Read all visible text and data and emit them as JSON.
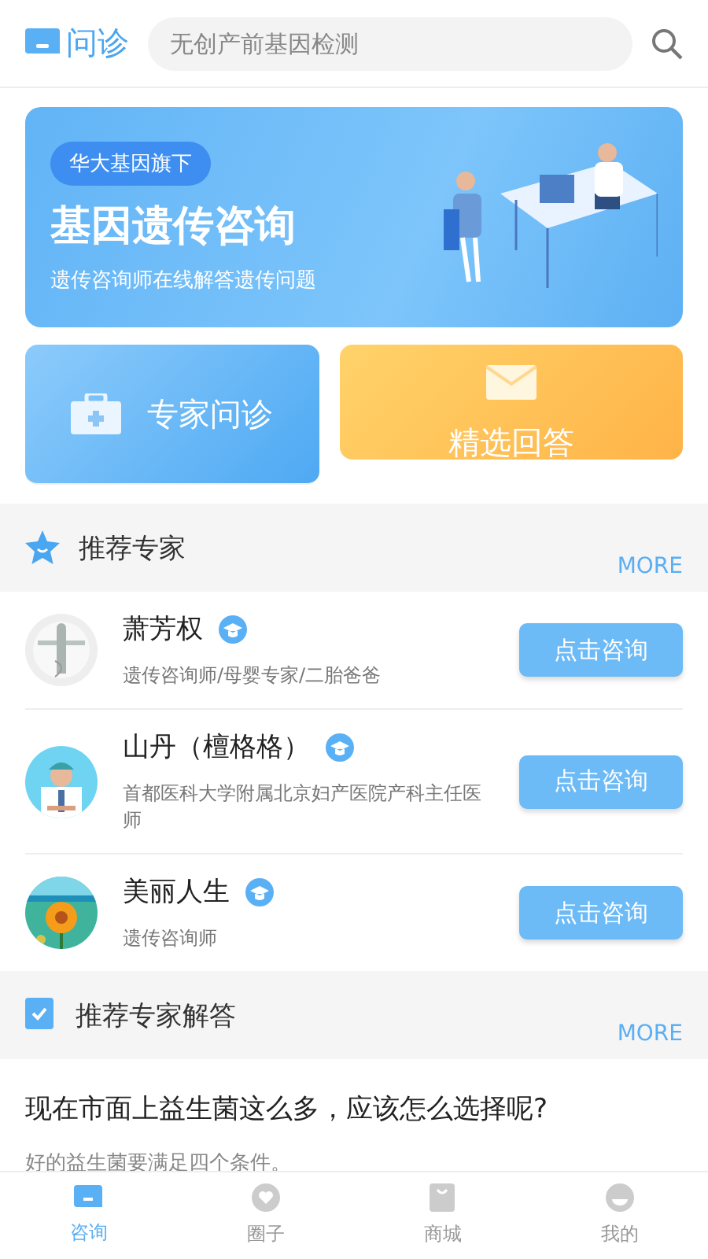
{
  "header": {
    "logo_text": "问诊",
    "search": {
      "placeholder": "无创产前基因检测"
    }
  },
  "banner": {
    "badge": "华大基因旗下",
    "title": "基因遗传咨询",
    "subtitle": "遗传咨询师在线解答遗传问题"
  },
  "shortcuts": [
    {
      "kind": "expert",
      "label": "专家问诊"
    },
    {
      "kind": "answers",
      "label": "精选回答"
    }
  ],
  "experts_section": {
    "title": "推荐专家",
    "more": "MORE",
    "experts": [
      {
        "name": "萧芳权",
        "description": "遗传咨询师/母婴专家/二胎爸爸",
        "button": "点击咨询"
      },
      {
        "name": "山丹（檀格格）",
        "description": "首都医科大学附属北京妇产医院产科主任医师",
        "button": "点击咨询"
      },
      {
        "name": "美丽人生",
        "description": "遗传咨询师",
        "button": "点击咨询"
      }
    ]
  },
  "answers_section": {
    "title": "推荐专家解答",
    "more": "MORE",
    "answers": [
      {
        "question": "现在市面上益生菌这么多，应该怎么选择呢?",
        "snippet": "好的益生菌要满足四个条件。"
      }
    ]
  },
  "tab_bar": [
    {
      "kind": "consult",
      "label": "咨询",
      "selected": true
    },
    {
      "kind": "circle",
      "label": "圈子",
      "selected": false
    },
    {
      "kind": "shop",
      "label": "商城",
      "selected": false
    },
    {
      "kind": "mine",
      "label": "我的",
      "selected": false
    }
  ]
}
